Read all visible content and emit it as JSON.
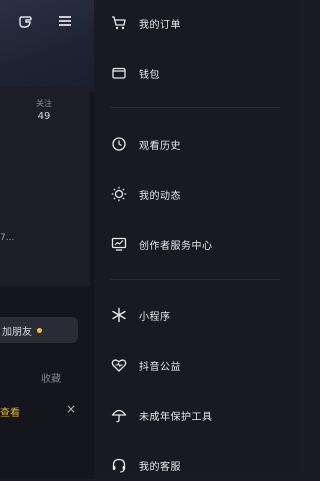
{
  "left_panel": {
    "stat_label": "关注",
    "stat_value": "49",
    "small_text": "7...",
    "friend_label": "加朋友",
    "collect_label": "收藏",
    "notice_label": "查看",
    "close_label": "×",
    "accent_color": "#f0c03a"
  },
  "menu": {
    "group1": [
      {
        "icon": "cart-icon",
        "label": "我的订单"
      },
      {
        "icon": "wallet-icon",
        "label": "钱包"
      }
    ],
    "group2": [
      {
        "icon": "clock-icon",
        "label": "观看历史"
      },
      {
        "icon": "sun-icon",
        "label": "我的动态"
      },
      {
        "icon": "monitor-icon",
        "label": "创作者服务中心"
      }
    ],
    "group3": [
      {
        "icon": "star-burst-icon",
        "label": "小程序"
      },
      {
        "icon": "heart-icon",
        "label": "抖音公益"
      },
      {
        "icon": "umbrella-icon",
        "label": "未成年保护工具"
      },
      {
        "icon": "headset-icon",
        "label": "我的客服"
      }
    ]
  }
}
